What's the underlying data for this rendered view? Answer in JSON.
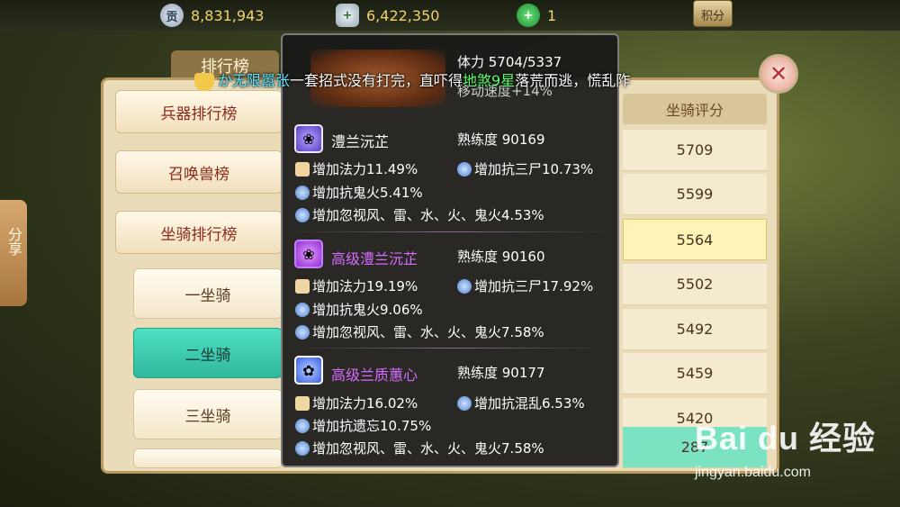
{
  "top_bar": {
    "resources": [
      {
        "icon": "gong-coin-icon",
        "glyph": "贡",
        "value": "8,831,943"
      },
      {
        "icon": "silver-ingot-icon",
        "glyph": "+",
        "value": "6,422,350"
      },
      {
        "icon": "jade-icon",
        "glyph": "+",
        "value": "1"
      }
    ],
    "jifen_label": "积分"
  },
  "panel": {
    "title": "排行榜",
    "tabs": [
      {
        "label": "兵器排行榜"
      },
      {
        "label": "召唤兽榜"
      },
      {
        "label": "坐骑排行榜"
      }
    ],
    "subtabs": [
      {
        "label": "一坐骑",
        "active": false
      },
      {
        "label": "二坐骑",
        "active": true
      },
      {
        "label": "三坐骑",
        "active": false
      }
    ],
    "column_header": "坐骑评分",
    "scores": [
      "5709",
      "5599",
      "5564",
      "5502",
      "5492",
      "5459",
      "5420",
      "287"
    ]
  },
  "share_label": "分享",
  "marquee": {
    "prefix": "",
    "name": "か无限嚣张",
    "text1": "一套招式没有打完，直吓得",
    "highlight": "地煞9星",
    "text2": "落荒而逃，慌乱阼"
  },
  "tooltip": {
    "stamina_label": "体力 5704/5337",
    "speed_label": "移动速度+14%",
    "skills": [
      {
        "name": "澧兰沅芷",
        "proficiency": "熟练度 90169",
        "attrs": [
          [
            "增加法力11.49%",
            "增加抗三尸10.73%"
          ],
          [
            "增加抗鬼火5.41%"
          ],
          [
            "增加忽视风、雷、水、火、鬼火4.53%"
          ]
        ]
      },
      {
        "name": "高级澧兰沅芷",
        "proficiency": "熟练度 90160",
        "attrs": [
          [
            "增加法力19.19%",
            "增加抗三尸17.92%"
          ],
          [
            "增加抗鬼火9.06%"
          ],
          [
            "增加忽视风、雷、水、火、鬼火7.58%"
          ]
        ]
      },
      {
        "name": "高级兰质蕙心",
        "proficiency": "熟练度 90177",
        "attrs": [
          [
            "增加法力16.02%",
            "增加抗混乱6.53%"
          ],
          [
            "增加抗遗忘10.75%"
          ],
          [
            "增加忽视风、雷、水、火、鬼火7.58%"
          ]
        ]
      }
    ]
  },
  "watermark": {
    "logo": "Bai du 经验",
    "url": "jingyan.baidu.com"
  },
  "colors": {
    "gold_text": "#f1d36b",
    "active_tab": "#2fb79c",
    "purple_title": "#d86bff",
    "marquee_name": "#5ee6ff",
    "marquee_highlight": "#5aff6a"
  }
}
